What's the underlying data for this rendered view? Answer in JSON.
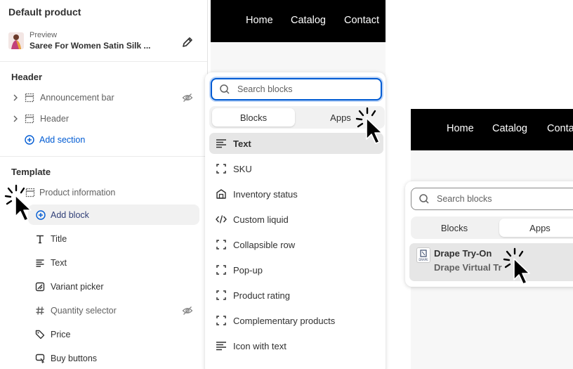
{
  "left_panel": {
    "title": "Default product",
    "preview_label": "Preview",
    "preview_value": "Saree For Women Satin Silk ...",
    "header_section": {
      "heading": "Header",
      "items": [
        {
          "label": "Announcement bar",
          "hidden": true
        },
        {
          "label": "Header",
          "hidden": false
        }
      ],
      "add_label": "Add section"
    },
    "template_section": {
      "heading": "Template",
      "group_label": "Product information",
      "add_label": "Add block",
      "blocks": [
        {
          "label": "Title",
          "icon": "title-icon",
          "hidden": false
        },
        {
          "label": "Text",
          "icon": "text-icon",
          "hidden": false
        },
        {
          "label": "Variant picker",
          "icon": "variant-picker-icon",
          "hidden": false
        },
        {
          "label": "Quantity selector",
          "icon": "hash-icon",
          "hidden": true
        },
        {
          "label": "Price",
          "icon": "price-tag-icon",
          "hidden": false
        },
        {
          "label": "Buy buttons",
          "icon": "buy-buttons-icon",
          "hidden": false
        }
      ]
    }
  },
  "storefront_nav": [
    "Home",
    "Catalog",
    "Contact"
  ],
  "storefront_nav_2": [
    "Home",
    "Catalog",
    "Conta"
  ],
  "block_picker": {
    "search_placeholder": "Search blocks",
    "tabs": [
      "Blocks",
      "Apps"
    ],
    "active_tab": "Blocks",
    "blocks": [
      {
        "label": "Text",
        "icon": "text-lines-icon",
        "selected": true
      },
      {
        "label": "SKU",
        "icon": "dashed-square-icon"
      },
      {
        "label": "Inventory status",
        "icon": "warehouse-icon"
      },
      {
        "label": "Custom liquid",
        "icon": "code-icon"
      },
      {
        "label": "Collapsible row",
        "icon": "dashed-square-icon"
      },
      {
        "label": "Pop-up",
        "icon": "dashed-square-icon"
      },
      {
        "label": "Product rating",
        "icon": "dashed-square-icon"
      },
      {
        "label": "Complementary products",
        "icon": "dashed-square-icon"
      },
      {
        "label": "Icon with text",
        "icon": "text-lines-icon"
      }
    ]
  },
  "apps_picker": {
    "search_placeholder": "Search blocks",
    "tabs": [
      "Blocks",
      "Apps"
    ],
    "active_tab": "Apps",
    "app": {
      "name": "Drape Try-On",
      "subtitle": "Drape Virtual Tr",
      "logo_text": "DRAPE"
    }
  },
  "colors": {
    "accent": "#005bd3",
    "nav_bg": "#000000",
    "selected_bg": "#e6e6e6"
  }
}
